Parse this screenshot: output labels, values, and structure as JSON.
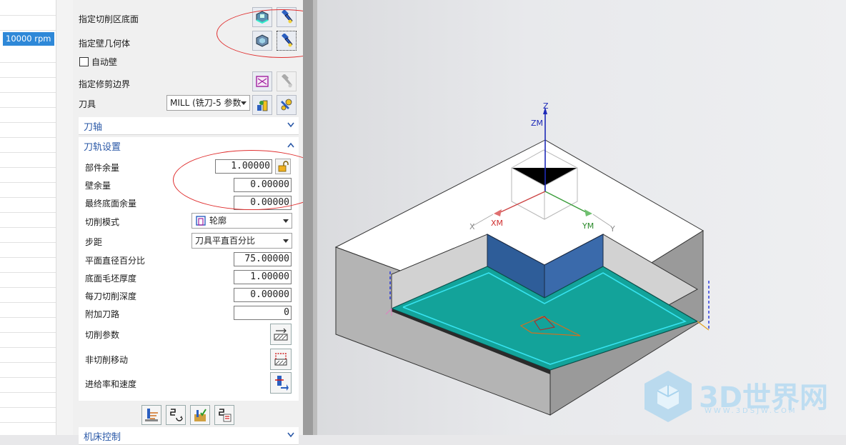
{
  "spreadsheet": {
    "spindle_value": "10000 rpm"
  },
  "geometry": {
    "floor_label": "指定切削区底面",
    "wall_label": "指定壁几何体",
    "auto_wall_label": "自动壁",
    "auto_wall_checked": false,
    "trim_label": "指定修剪边界"
  },
  "tool": {
    "label": "刀具",
    "value": "MILL (铣刀-5 参数"
  },
  "sections": {
    "tool_axis": "刀轴",
    "path_settings": "刀轨设置",
    "bottom": "机床控制"
  },
  "settings": {
    "part_stock": {
      "label": "部件余量",
      "value": "1.00000"
    },
    "wall_stock": {
      "label": "壁余量",
      "value": "0.00000"
    },
    "final_floor_stock": {
      "label": "最终底面余量",
      "value": "0.00000"
    },
    "cut_pattern": {
      "label": "切削模式",
      "value": "轮廓"
    },
    "stepover": {
      "label": "步距",
      "value": "刀具平直百分比"
    },
    "flat_diameter_pct": {
      "label": "平面直径百分比",
      "value": "75.00000"
    },
    "floor_blank_thickness": {
      "label": "底面毛坯厚度",
      "value": "1.00000"
    },
    "depth_per_cut": {
      "label": "每刀切削深度",
      "value": "0.00000"
    },
    "additional_passes": {
      "label": "附加刀路",
      "value": "0"
    },
    "cutting_params": {
      "label": "切削参数"
    },
    "non_cutting_moves": {
      "label": "非切削移动"
    },
    "feeds_speeds": {
      "label": "进给率和速度"
    }
  },
  "viewport": {
    "axes": {
      "z": "Z",
      "zm": "ZM",
      "x": "X",
      "xm": "XM",
      "ym": "YM",
      "y": "Y"
    },
    "watermark_text": "3D世界网",
    "watermark_url": "WWW.3DSJW.COM"
  },
  "colors": {
    "floor": "#13a39a",
    "wall": "#2e5d99",
    "annotation": "#e03030",
    "accent": "#2a58a7"
  }
}
